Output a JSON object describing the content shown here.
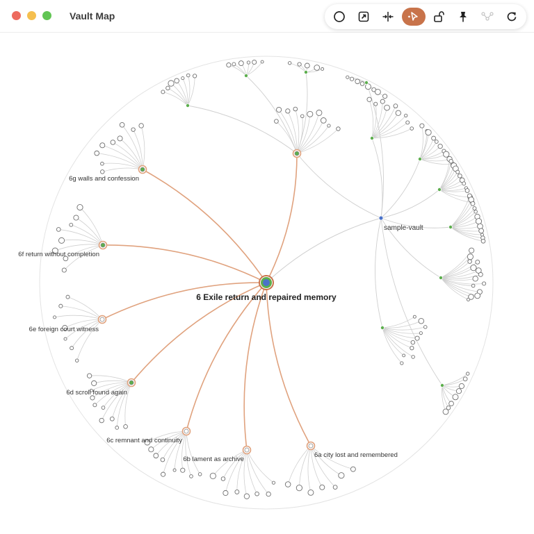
{
  "window": {
    "title": "Vault Map",
    "traffic_lights": {
      "close": "#ed6a5e",
      "minimize": "#f5bf4f",
      "zoom": "#61c554"
    }
  },
  "toolbar": [
    {
      "name": "circle-layout-button",
      "icon": "circle-icon",
      "active": false,
      "enabled": true
    },
    {
      "name": "open-external-button",
      "icon": "external-link-icon",
      "active": false,
      "enabled": true
    },
    {
      "name": "collapse-button",
      "icon": "collapse-arrows-icon",
      "active": false,
      "enabled": true
    },
    {
      "name": "select-mode-button",
      "icon": "cursor-icon",
      "active": true,
      "enabled": true
    },
    {
      "name": "unlock-button",
      "icon": "unlock-icon",
      "active": false,
      "enabled": true
    },
    {
      "name": "pin-button",
      "icon": "pin-icon",
      "active": false,
      "enabled": true
    },
    {
      "name": "graph-button",
      "icon": "graph-icon",
      "active": false,
      "enabled": false
    },
    {
      "name": "refresh-button",
      "icon": "refresh-icon",
      "active": false,
      "enabled": true
    }
  ],
  "colors": {
    "accent": "#c8734a",
    "highlight_edge": "#e0a27e",
    "edge": "#cfcfcf",
    "node_green": "#5cae4d",
    "node_blue": "#4a72c9",
    "outer_ring": "#e3e3e3"
  },
  "graph": {
    "focus": {
      "label": "6  Exile return and repaired memory"
    },
    "root": {
      "label": "sample-vault"
    },
    "children": [
      {
        "label": "6a  city lost and remembered",
        "green": false
      },
      {
        "label": "6b  lament as archive",
        "green": false
      },
      {
        "label": "6c  remnant and continuity",
        "green": false
      },
      {
        "label": "6d  scroll found again",
        "green": true
      },
      {
        "label": "6e  foreign court witness",
        "green": false
      },
      {
        "label": "6f  return without completion",
        "green": true
      },
      {
        "label": "6g  walls and confession",
        "green": true
      },
      {
        "label": "",
        "green": true
      }
    ]
  }
}
